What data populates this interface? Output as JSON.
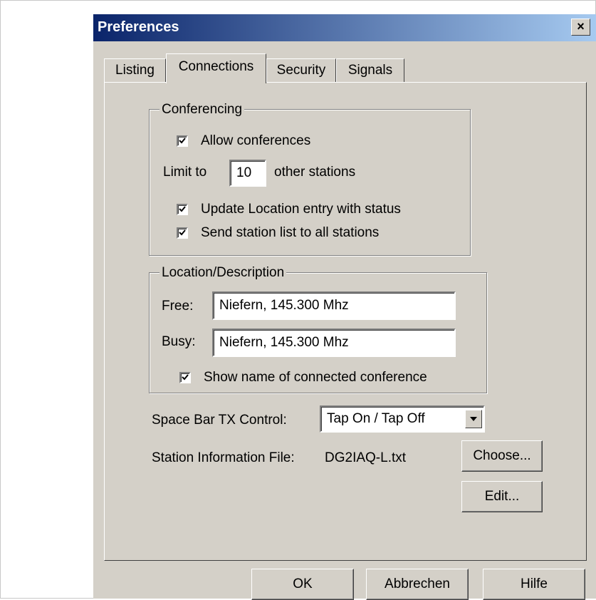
{
  "dialog": {
    "title": "Preferences",
    "close_label": "×"
  },
  "tabs": [
    {
      "label": "Listing"
    },
    {
      "label": "Connections"
    },
    {
      "label": "Security"
    },
    {
      "label": "Signals"
    }
  ],
  "active_tab": "Connections",
  "conferencing": {
    "title": "Conferencing",
    "allow_conferences": {
      "label": "Allow conferences",
      "checked": true
    },
    "limit_prefix": "Limit to",
    "limit_value": "10",
    "limit_suffix": "other stations",
    "update_location": {
      "label": "Update Location entry with status",
      "checked": true
    },
    "send_station_list": {
      "label": "Send station list to all stations",
      "checked": true
    }
  },
  "location": {
    "title": "Location/Description",
    "free_label": "Free:",
    "free_value": "Niefern, 145.300 Mhz",
    "busy_label": "Busy:",
    "busy_value": "Niefern, 145.300 Mhz",
    "show_name": {
      "label": "Show name of connected conference",
      "checked": true
    }
  },
  "space_bar": {
    "label": "Space Bar TX Control:",
    "selected": "Tap On / Tap Off"
  },
  "station_info": {
    "label": "Station Information File:",
    "file": "DG2IAQ-L.txt",
    "choose_label": "Choose...",
    "edit_label": "Edit..."
  },
  "footer": {
    "ok_label": "OK",
    "cancel_label": "Abbrechen",
    "help_label": "Hilfe"
  }
}
